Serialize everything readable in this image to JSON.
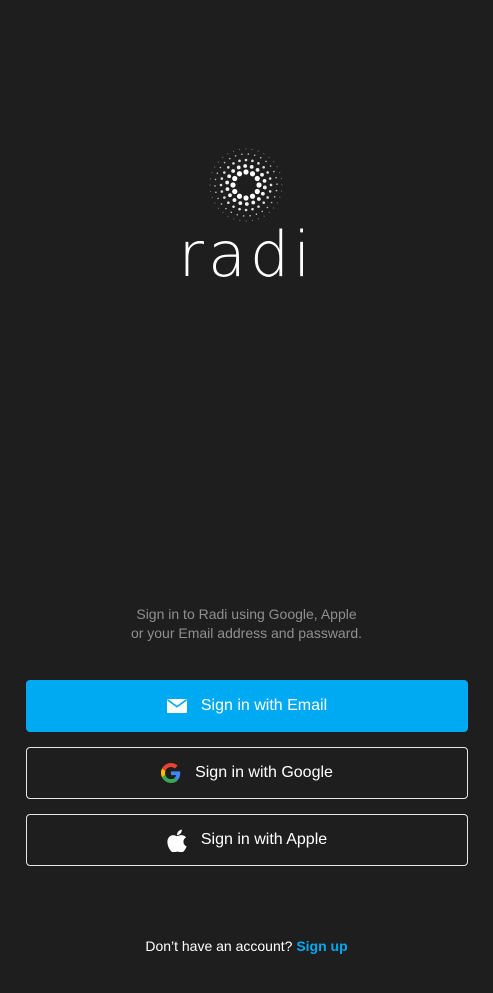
{
  "app": {
    "name": "radi",
    "brand_color": "#00aaf2",
    "background_color": "#1e1e1e"
  },
  "intro": {
    "line1": "Sign in to Radi using Google, Apple",
    "line2": "or your Email address and passward."
  },
  "buttons": {
    "email": {
      "label": "Sign in with Email",
      "icon": "mail-icon"
    },
    "google": {
      "label": "Sign in with Google",
      "icon": "google-icon"
    },
    "apple": {
      "label": "Sign in with Apple",
      "icon": "apple-icon"
    }
  },
  "footer": {
    "prompt": "Don’t have an account?",
    "link": "Sign up"
  }
}
